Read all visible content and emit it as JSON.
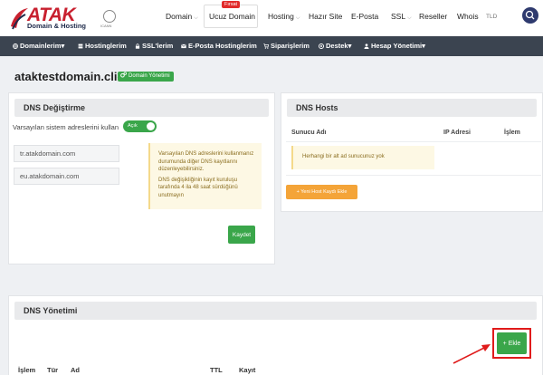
{
  "brand": {
    "name": "ATAK",
    "tagline": "Domain & Hosting",
    "icann": "ICANN"
  },
  "topnav": {
    "items": [
      {
        "label": "Domain",
        "chevron": true
      },
      {
        "label": "Ucuz Domain",
        "chevron": false
      },
      {
        "label": "Hosting",
        "chevron": true
      },
      {
        "label": "Hazır Site",
        "chevron": false
      },
      {
        "label": "E-Posta",
        "chevron": false
      },
      {
        "label": "SSL",
        "chevron": true
      },
      {
        "label": "Reseller",
        "chevron": false
      },
      {
        "label": "Whois",
        "chevron": false
      }
    ],
    "badge": "Fırsat",
    "search_placeholder": "TLD"
  },
  "mainnav": {
    "items": [
      {
        "label": "Domainlerim",
        "icon": "globe-icon",
        "caret": true
      },
      {
        "label": "Hostinglerim",
        "icon": "server-icon",
        "caret": false
      },
      {
        "label": "SSL'lerim",
        "icon": "lock-icon",
        "caret": false
      },
      {
        "label": "E-Posta Hostinglerim",
        "icon": "envelope-icon",
        "caret": false
      },
      {
        "label": "Siparişlerim",
        "icon": "cart-icon",
        "caret": false
      },
      {
        "label": "Destek",
        "icon": "support-icon",
        "caret": true
      },
      {
        "label": "Hesap Yönetimi",
        "icon": "user-icon",
        "caret": true
      }
    ]
  },
  "page": {
    "title": "ataktestdomain.click",
    "badge": "Domain Yönetimi"
  },
  "dns_change": {
    "title": "DNS Değiştirme",
    "default_label": "Varsayılan sistem adreslerini kullan",
    "toggle_label": "Açık",
    "nameservers": [
      "tr.atakdomain.com",
      "eu.atakdomain.com"
    ],
    "info_1": "Varsayılan DNS adreslerini kullanmanız durumunda diğer DNS kayıtlarını düzenleyebilirsiniz.",
    "info_2": "DNS değişikliğinin kayıt kuruluşu tarafında 4 ila 48 saat sürdüğünü unutmayın",
    "save_label": "Kaydet"
  },
  "dns_hosts": {
    "title": "DNS Hosts",
    "columns": [
      "Sunucu Adı",
      "IP Adresi",
      "İşlem"
    ],
    "empty": "Herhangi bir alt ad sunucunuz yok",
    "add_label": "+ Yeni Host Kaydı Ekle"
  },
  "dns_management": {
    "title": "DNS Yönetimi",
    "add_label": "Ekle",
    "columns": [
      "İşlem",
      "Tür",
      "Ad",
      "TTL",
      "Kayıt"
    ]
  },
  "colors": {
    "green": "#3aa64a",
    "orange": "#f4a438",
    "red": "#e01b1b",
    "dark": "#3b4450",
    "navy": "#2e3a6e"
  }
}
